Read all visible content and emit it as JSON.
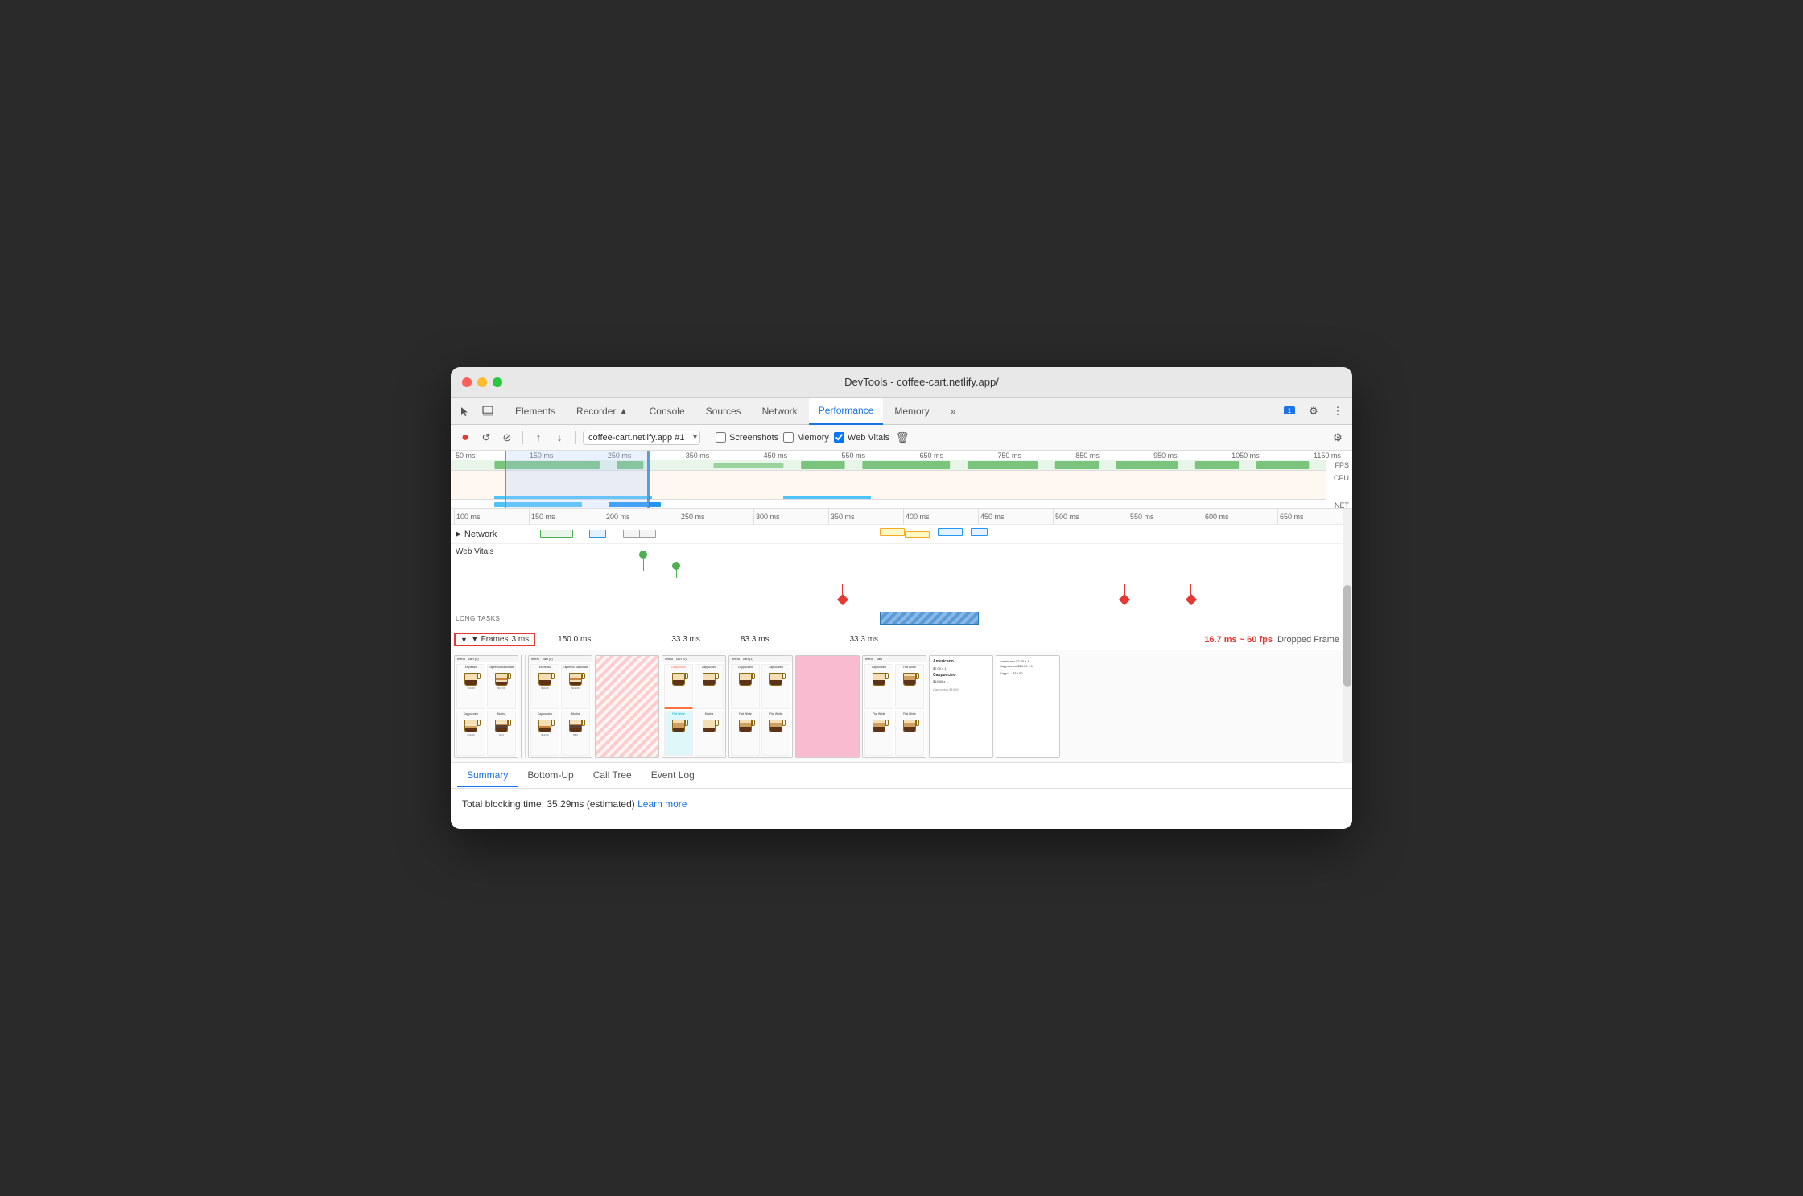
{
  "window": {
    "title": "DevTools - coffee-cart.netlify.app/"
  },
  "tabs": [
    {
      "label": "Elements",
      "active": false
    },
    {
      "label": "Recorder ▲",
      "active": false
    },
    {
      "label": "Console",
      "active": false
    },
    {
      "label": "Sources",
      "active": false
    },
    {
      "label": "Network",
      "active": false
    },
    {
      "label": "Performance",
      "active": true
    },
    {
      "label": "Memory",
      "active": false
    },
    {
      "label": "»",
      "active": false
    }
  ],
  "toolbar": {
    "record_label": "●",
    "reload_label": "↺",
    "clear_label": "🚫",
    "upload_label": "↑",
    "download_label": "↓",
    "session_label": "coffee-cart.netlify.app #1",
    "screenshots_label": "Screenshots",
    "memory_label": "Memory",
    "web_vitals_label": "Web Vitals",
    "trash_label": "🗑",
    "settings_label": "⚙"
  },
  "overview": {
    "labels": [
      "50 ms",
      "150 ms",
      "250 ms",
      "350 ms",
      "450 ms",
      "550 ms",
      "650 ms",
      "750 ms",
      "850 ms",
      "950 ms",
      "1050 ms",
      "1150 ms"
    ],
    "side_labels": [
      "FPS",
      "CPU",
      "NET"
    ]
  },
  "ruler": {
    "ticks": [
      "100 ms",
      "150 ms",
      "200 ms",
      "250 ms",
      "300 ms",
      "350 ms",
      "400 ms",
      "450 ms",
      "500 ms",
      "550 ms",
      "600 ms",
      "650 ms"
    ]
  },
  "tracks": {
    "network_label": "▶ Network",
    "web_vitals_label": "Web Vitals",
    "long_tasks_label": "LONG TASKS"
  },
  "ls_markers": [
    "LS",
    "LS",
    "LS"
  ],
  "frames": {
    "label": "▼ Frames",
    "ms_label": "3 ms",
    "timings": [
      "150.0 ms",
      "33.3 ms",
      "83.3 ms",
      "33.3 ms"
    ],
    "dropped_info": "16.7 ms ~ 60 fps",
    "dropped_label": "Dropped Frame"
  },
  "bottom_tabs": [
    "Summary",
    "Bottom-Up",
    "Call Tree",
    "Event Log"
  ],
  "active_bottom_tab": "Summary",
  "summary": {
    "text": "Total blocking time: 35.29ms (estimated)",
    "learn_more": "Learn more"
  },
  "badge_count": "1"
}
